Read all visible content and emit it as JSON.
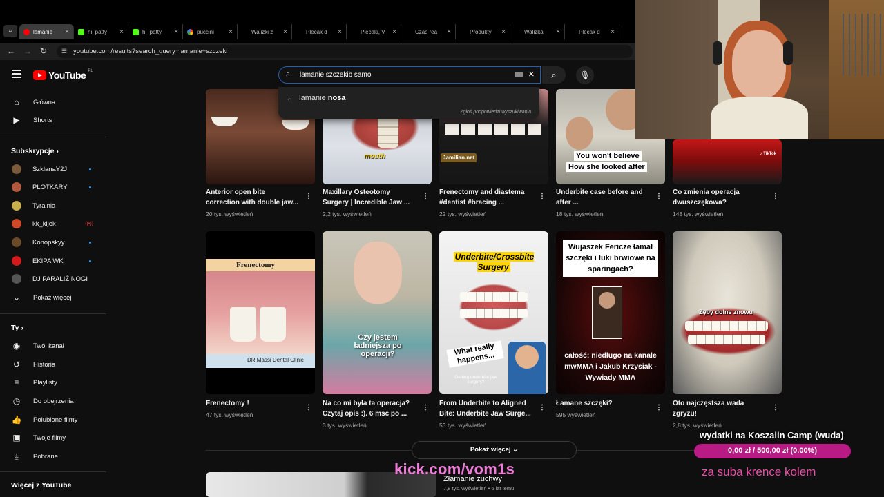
{
  "browser": {
    "tabs": [
      {
        "title": "lamanie",
        "fav": "youtube-icon",
        "color": "#ff0000",
        "active": true
      },
      {
        "title": "hi_patty",
        "fav": "kick-icon",
        "color": "#53fc18"
      },
      {
        "title": "hi_patty",
        "fav": "kick-icon",
        "color": "#53fc18"
      },
      {
        "title": "puccini",
        "fav": "google-icon",
        "color": "#4285f4"
      },
      {
        "title": "Walizki z",
        "fav": "",
        "color": "#000000"
      },
      {
        "title": "Plecak d",
        "fav": "",
        "color": "#000000"
      },
      {
        "title": "Plecaki, V",
        "fav": "",
        "color": "#000000"
      },
      {
        "title": "Czas rea",
        "fav": "",
        "color": "#000000"
      },
      {
        "title": "Produkty",
        "fav": "",
        "color": "#000000"
      },
      {
        "title": "Walizka",
        "fav": "",
        "color": "#000000"
      },
      {
        "title": "Plecak d",
        "fav": "",
        "color": "#000000"
      }
    ],
    "url": "youtube.com/results?search_query=lamanie+szczeki"
  },
  "header": {
    "logo": "YouTube",
    "country": "PL",
    "search_value": "lamanie szczekib samo"
  },
  "suggest": {
    "prefix": "lamanie ",
    "bold": "nosa",
    "note": "Zgłoś podpowiedzi wyszukiwania"
  },
  "sidebar": {
    "main": [
      {
        "label": "Główna",
        "icon": "home-icon"
      },
      {
        "label": "Shorts",
        "icon": "shorts-icon"
      }
    ],
    "subs_title": "Subskrypcje",
    "subs": [
      {
        "label": "SzklanaY2J",
        "color": "#7a5a3a"
      },
      {
        "label": "PLOTKARY",
        "color": "#b2583c"
      },
      {
        "label": "Tyralnia",
        "color": "#c9b04c"
      },
      {
        "label": "kk_kijek",
        "color": "#d04a2a"
      },
      {
        "label": "Konopskyy",
        "color": "#6b4a2a"
      },
      {
        "label": "EKIPA WK",
        "color": "#d21a1a"
      },
      {
        "label": "DJ PARALIŻ NOGI",
        "color": "#555555"
      }
    ],
    "show_more": "Pokaż więcej",
    "you_title": "Ty",
    "you": [
      {
        "label": "Twój kanał"
      },
      {
        "label": "Historia"
      },
      {
        "label": "Playlisty"
      },
      {
        "label": "Do obejrzenia"
      },
      {
        "label": "Polubione filmy"
      },
      {
        "label": "Twoje filmy"
      },
      {
        "label": "Pobrane"
      }
    ],
    "more_title": "Więcej z YouTube"
  },
  "row1": [
    {
      "title1": "Anterior open bite",
      "title2": "correction with double jaw...",
      "meta": "20 tys. wyświetleń"
    },
    {
      "title1": "Maxillary Osteotomy",
      "title2": "Surgery | Incredible Jaw ...",
      "meta": "2,2 tys. wyświetleń",
      "cap": "mouth"
    },
    {
      "title1": "Frenectomy and diastema",
      "title2": "#dentist #bracing ...",
      "meta": "22 tys. wyświetleń",
      "cap": "Jamilian.net"
    },
    {
      "title1": "Underbite case before and",
      "title2": "after ...",
      "meta": "18 tys. wyświetleń",
      "cap1": "You won't believe",
      "cap2": "How she looked after"
    },
    {
      "title1": "Co zmienia operacja",
      "title2": "dwuszczękowa?",
      "meta": "148 tys. wyświetleń"
    }
  ],
  "row2": [
    {
      "title1": "Frenectomy !",
      "title2": "",
      "meta": "47 tys. wyświetleń",
      "cap": "Frenectomy",
      "cap2": "DR Massi Dental Clinic"
    },
    {
      "title1": "Na co mi była ta operacja?",
      "title2": "Czytaj opis :). 6 msc po ...",
      "meta": "3 tys. wyświetleń",
      "cap": "Czy jestem ładniejsza po operacji?"
    },
    {
      "title1": "From Underbite to Aligned",
      "title2": "Bite: Underbite Jaw Surge...",
      "meta": "53 tys. wyświetleń",
      "cap": "Underbite/Crossbite Surgery",
      "cap2": "What really happens...",
      "cap3": "Getting underbite jaw surgery?"
    },
    {
      "title1": "Łamane szczęki?",
      "title2": "",
      "meta": "595 wyświetleń",
      "cap": "Wujaszek Fericze łamał szczęki i łuki brwiowe na sparingach?",
      "cap2": "całość: niedługo na kanale mwMMA i Jakub Krzysiak - Wywiady MMA"
    },
    {
      "title1": "Oto najczęstsza wada",
      "title2": "zgryzu!",
      "meta": "2,8 tys. wyświetleń",
      "cap": "Zęby dolne znowu"
    }
  ],
  "more_button": "Pokaż więcej",
  "bottom_video": {
    "title": "Złamanie żuchwy",
    "meta1": "7,8 tys. wyświetleń",
    "meta2": "6 lat temu"
  },
  "overlay": {
    "kick_url": "kick.com/vom1s",
    "goal_title": "wydatki na Koszalin Camp (wuda)",
    "goal_amount": "0,00 zł / 500,00 zł (0.00%)",
    "goal_progress": 0,
    "goal_sub": "za suba krence kolem"
  }
}
